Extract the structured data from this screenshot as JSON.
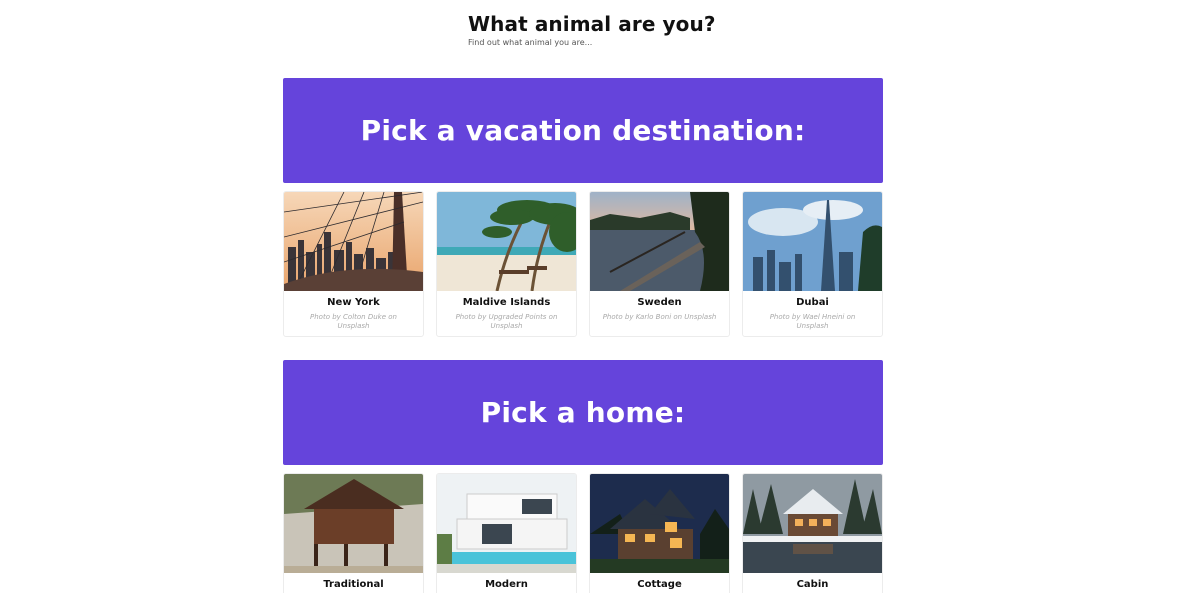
{
  "header": {
    "title": "What animal are you?",
    "subtitle": "Find out what animal you are..."
  },
  "sections": [
    {
      "title": "Pick a vacation destination:",
      "options": [
        {
          "label": "New York",
          "credit": "Photo by Colton Duke on Unsplash",
          "image": "city-skyline-bridge-photo"
        },
        {
          "label": "Maldive Islands",
          "credit": "Photo by Upgraded Points on Unsplash",
          "image": "tropical-beach-photo"
        },
        {
          "label": "Sweden",
          "credit": "Photo by Karlo Boni on Unsplash",
          "image": "lake-pier-photo"
        },
        {
          "label": "Dubai",
          "credit": "Photo by Wael Hneini on Unsplash",
          "image": "skyscraper-city-photo"
        }
      ]
    },
    {
      "title": "Pick a home:",
      "options": [
        {
          "label": "Traditional",
          "image": "wooden-stilt-house-photo"
        },
        {
          "label": "Modern",
          "image": "modern-villa-pool-photo"
        },
        {
          "label": "Cottage",
          "image": "cottage-night-photo"
        },
        {
          "label": "Cabin",
          "image": "snowy-cabin-photo"
        }
      ]
    }
  ],
  "colors": {
    "banner": "#6544db",
    "title_text": "#111111",
    "credit_text": "#a9a9a9"
  }
}
